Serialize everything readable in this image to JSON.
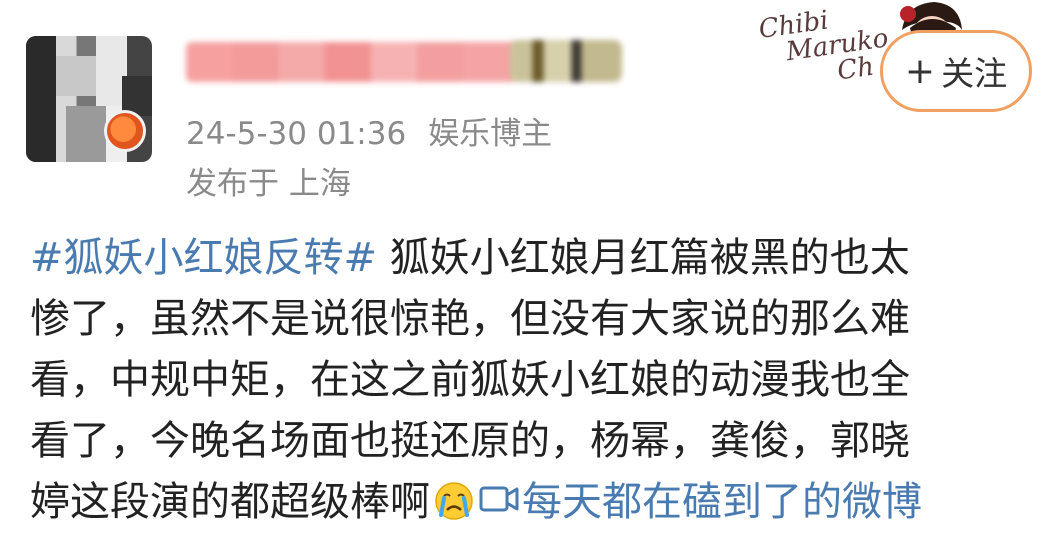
{
  "post": {
    "meta_time": "24-5-30 01:36",
    "meta_type": "娱乐博主",
    "location": "发布于 上海",
    "follow": {
      "plus": "+",
      "label": "关注"
    },
    "decoration_text": [
      "Chibi",
      "Maruko",
      "Ch"
    ],
    "hashtag": "#狐妖小红娘反转#",
    "lines": [
      " 狐妖小红娘月红篇被黑的也太",
      "惨了，虽然不是说很惊艳，但没有大家说的那么难",
      "看，中规中矩，在这之前狐妖小红娘的动漫我也全",
      "看了，今晚名场面也挺还原的，杨幂，龚俊，郭晓",
      "婷这段演的都超级棒啊"
    ],
    "link_text": "每天都在磕到了的微博",
    "icons": {
      "emoji": "crying-face-icon",
      "video": "video-camera-icon"
    },
    "colors": {
      "link": "#4a7bb0",
      "meta": "#8a8a8a",
      "follow_border": "#f0a060"
    }
  }
}
